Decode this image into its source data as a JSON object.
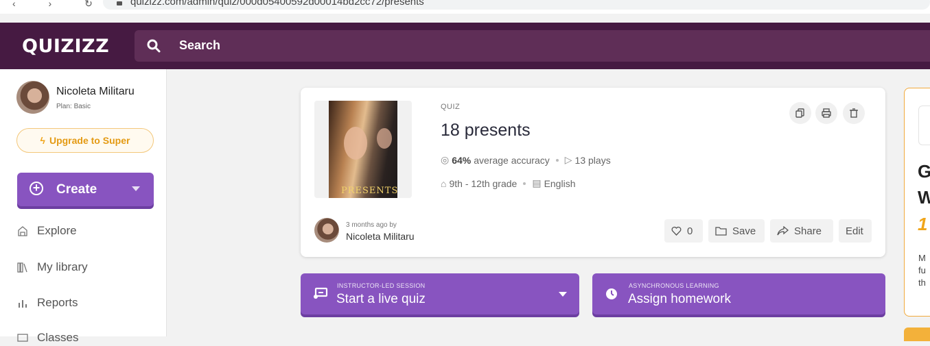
{
  "browser": {
    "url": "quizizz.com/admin/quiz/000d05400592d00014bd2cc72/presents"
  },
  "header": {
    "logo": "QUIZIZZ",
    "search_label": "Search"
  },
  "sidebar": {
    "user_name": "Nicoleta Militaru",
    "plan": "Plan: Basic",
    "upgrade_label": "Upgrade to Super",
    "create_label": "Create",
    "items": [
      {
        "label": "Explore",
        "icon": "explore-icon"
      },
      {
        "label": "My library",
        "icon": "library-icon"
      },
      {
        "label": "Reports",
        "icon": "reports-icon"
      },
      {
        "label": "Classes",
        "icon": "classes-icon"
      }
    ]
  },
  "quiz": {
    "type": "QUIZ",
    "title": "18 presents",
    "thumbnail_text": "PRESENTS",
    "accuracy": "64%",
    "accuracy_label": "average accuracy",
    "plays": "13 plays",
    "grade": "9th - 12th grade",
    "language": "English",
    "ago": "3 months ago by",
    "author": "Nicoleta Militaru",
    "likes": "0",
    "save_label": "Save",
    "share_label": "Share",
    "edit_label": "Edit"
  },
  "actions": {
    "live_caption": "INSTRUCTOR-LED SESSION",
    "live_label": "Start a live quiz",
    "hw_caption": "ASYNCHRONOUS LEARNING",
    "hw_label": "Assign homework"
  },
  "promo": {
    "line1": "G",
    "line2": "W",
    "line3": "1",
    "text1": "M",
    "text2": "fu",
    "text3": "th"
  },
  "colors": {
    "header": "#461a42",
    "search": "#5f2e57",
    "primary": "#8854c0",
    "accent": "#f0a51a"
  }
}
